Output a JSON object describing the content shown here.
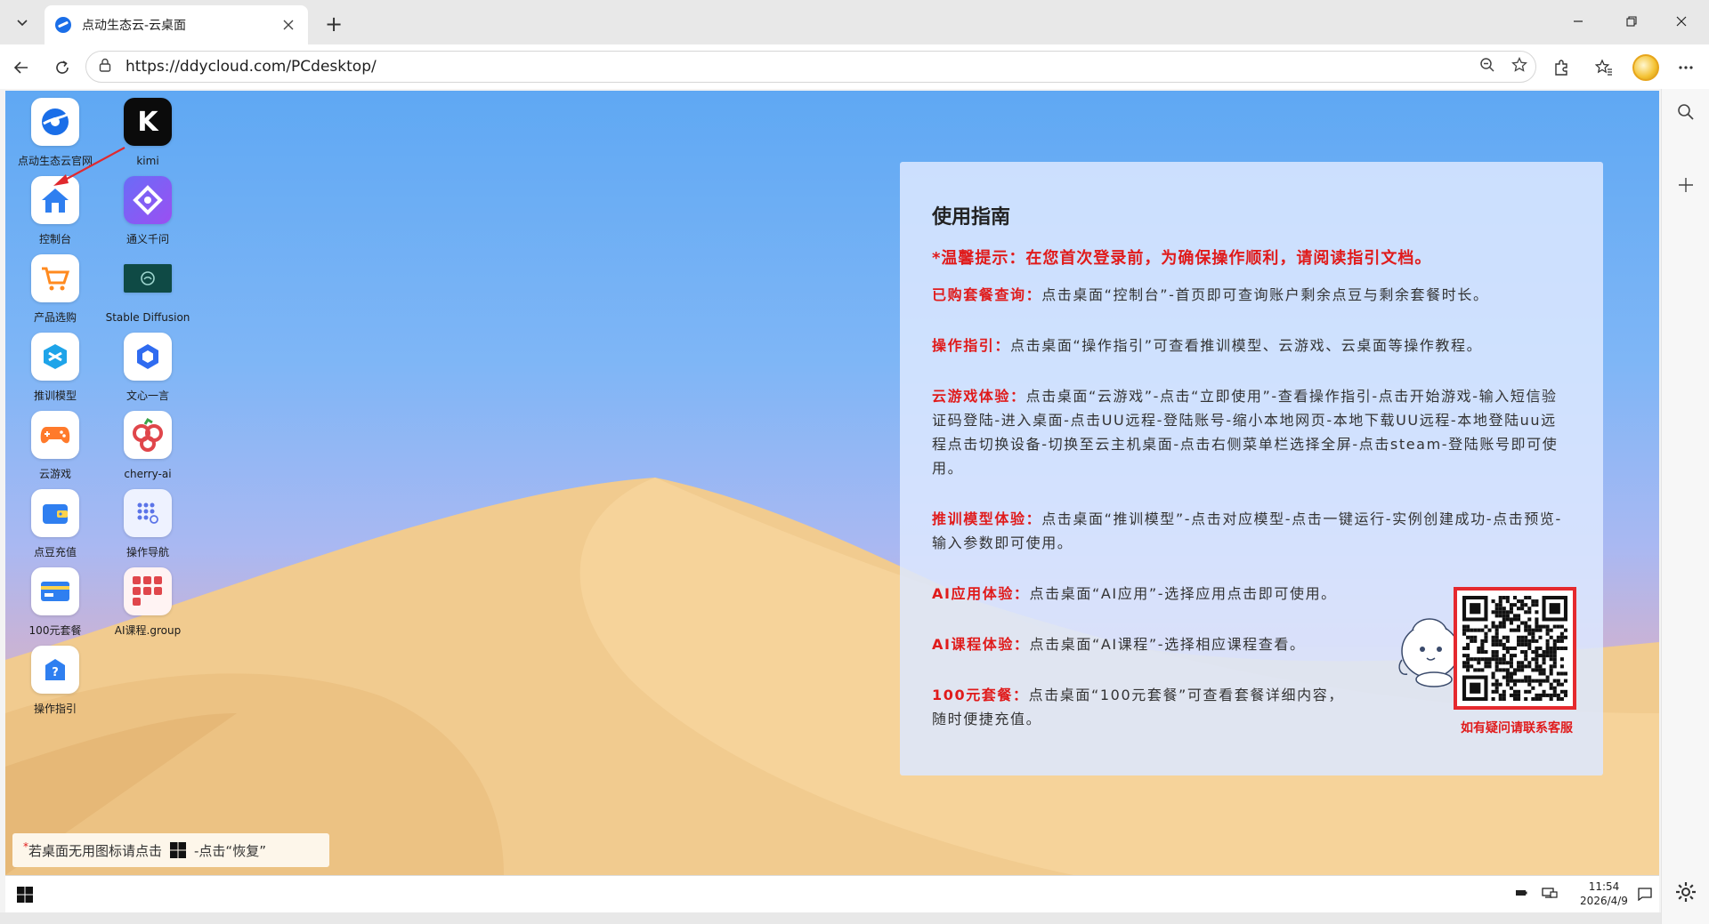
{
  "browser": {
    "tab_title": "点动生态云-云桌面",
    "url": "https://ddycloud.com/PCdesktop/",
    "new_tab_label": "+",
    "icons": {
      "tab_menu": "chevron-down-icon",
      "close": "close-icon",
      "back": "back-arrow-icon",
      "reload": "reload-icon",
      "site_info": "lock-icon",
      "zoom": "zoom-out-icon",
      "favorite": "star-icon",
      "extensions": "puzzle-icon",
      "favorites": "favorites-icon",
      "more": "more-icon",
      "search": "search-icon",
      "add": "plus-icon",
      "settings": "gear-icon"
    }
  },
  "desktop": {
    "icons": [
      {
        "label": "点动生态云官网",
        "name": "ddy-official-site",
        "glyph": "●",
        "bg": "#ffffff",
        "fg": "#1a6ee8"
      },
      {
        "label": "kimi",
        "name": "kimi",
        "glyph": "K",
        "bg": "#0b0b0b",
        "fg": "#ffffff"
      },
      {
        "label": "控制台",
        "name": "console",
        "glyph": "⌂",
        "bg": "#ffffff",
        "fg": "#2f7ff0"
      },
      {
        "label": "通义千问",
        "name": "tongyi-qianwen",
        "glyph": "✦",
        "bg": "#7b5cf5",
        "fg": "#ffffff"
      },
      {
        "label": "产品选购",
        "name": "product-purchase",
        "glyph": "🛒",
        "bg": "#ffffff",
        "fg": "#ff8a1f"
      },
      {
        "label": "Stable Diffusion",
        "name": "stable-diffusion",
        "glyph": "◎",
        "bg": "#0f4a45",
        "fg": "#9ed6cf"
      },
      {
        "label": "推训模型",
        "name": "training-model",
        "glyph": "◆",
        "bg": "#ffffff",
        "fg": "#1ea4e9"
      },
      {
        "label": "文心一言",
        "name": "wenxin-yiyan",
        "glyph": "⬡",
        "bg": "#ffffff",
        "fg": "#2f6bf0"
      },
      {
        "label": "云游戏",
        "name": "cloud-game",
        "glyph": "🎮",
        "bg": "#ffffff",
        "fg": "#ff7a2b"
      },
      {
        "label": "cherry-ai",
        "name": "cherry-ai",
        "glyph": "❀",
        "bg": "#ffffff",
        "fg": "#e0464b"
      },
      {
        "label": "点豆充值",
        "name": "dou-recharge",
        "glyph": "▣",
        "bg": "#ffffff",
        "fg": "#2f7ff0"
      },
      {
        "label": "操作导航",
        "name": "operation-nav",
        "glyph": "⋮⋮",
        "bg": "#eef2ff",
        "fg": "#5b74e8"
      },
      {
        "label": "100元套餐",
        "name": "package-100",
        "glyph": "▭",
        "bg": "#ffffff",
        "fg": "#2f7ff0"
      },
      {
        "label": "AI课程.group",
        "name": "ai-course-group",
        "glyph": "▦",
        "bg": "#fff3f3",
        "fg": "#e0464b"
      },
      {
        "label": "操作指引",
        "name": "operation-guide",
        "glyph": "?",
        "bg": "#ffffff",
        "fg": "#2f7ff0"
      }
    ],
    "restore_tip": {
      "star": "*",
      "before": "若桌面无用图标请点击",
      "after": "-点击“恢复”"
    },
    "clock": {
      "time": "11:54",
      "date": "2026/4/9"
    }
  },
  "guide": {
    "title": "使用指南",
    "notice": "*温馨提示：在您首次登录前，为确保操作顺利，请阅读指引文档。",
    "sections": [
      {
        "key": "已购套餐查询：",
        "text": "点击桌面“控制台”-首页即可查询账户剩余点豆与剩余套餐时长。"
      },
      {
        "key": "操作指引：",
        "text": "点击桌面“操作指引”可查看推训模型、云游戏、云桌面等操作教程。"
      },
      {
        "key": "云游戏体验：",
        "text": "点击桌面“云游戏”-点击“立即使用”-查看操作指引-点击开始游戏-输入短信验证码登陆-进入桌面-点击UU远程-登陆账号-缩小本地网页-本地下载UU远程-本地登陆uu远程点击切换设备-切换至云主机桌面-点击右侧菜单栏选择全屏-点击steam-登陆账号即可使用。"
      },
      {
        "key": "推训模型体验：",
        "text": "点击桌面“推训模型”-点击对应模型-点击一键运行-实例创建成功-点击预览-输入参数即可使用。"
      },
      {
        "key": "AI应用体验：",
        "text": "点击桌面“AI应用”-选择应用点击即可使用。"
      },
      {
        "key": "AI课程体验：",
        "text": "点击桌面“AI课程”-选择相应课程查看。"
      },
      {
        "key": "100元套餐：",
        "text": "点击桌面“100元套餐”可查看套餐详细内容，随时便捷充值。"
      }
    ],
    "qr_caption": "如有疑问请联系客服"
  },
  "colors": {
    "accent_red": "#e01b1b",
    "brand_blue": "#1a6ee8"
  }
}
